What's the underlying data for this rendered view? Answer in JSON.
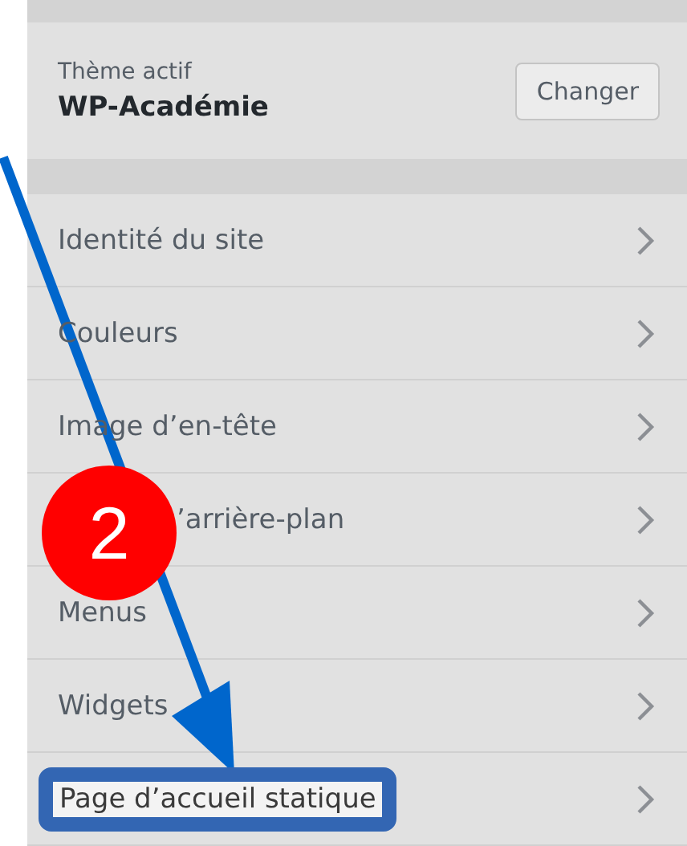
{
  "theme": {
    "label": "Thème actif",
    "name": "WP-Académie",
    "button": "Changer"
  },
  "sections": [
    {
      "label": "Identité du site",
      "highlighted": false
    },
    {
      "label": "Couleurs",
      "highlighted": false
    },
    {
      "label": "Image d’en-tête",
      "highlighted": false
    },
    {
      "label": "’arrière-plan",
      "highlighted": false,
      "badge": "2"
    },
    {
      "label": "Menus",
      "highlighted": false
    },
    {
      "label": "Widgets",
      "highlighted": false
    },
    {
      "label": "Page d’accueil statique",
      "highlighted": true
    }
  ]
}
